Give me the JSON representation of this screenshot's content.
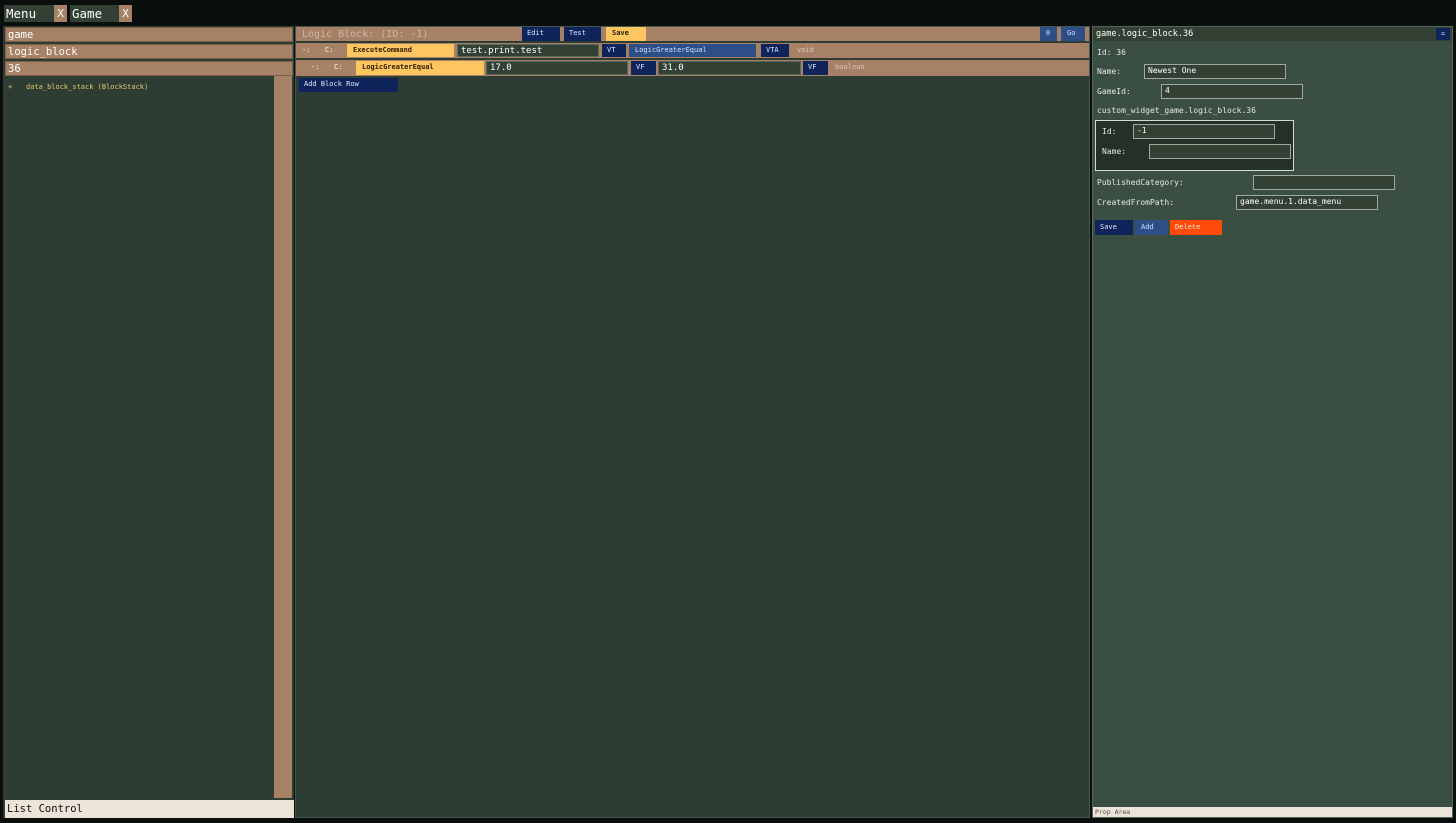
{
  "tabs": [
    {
      "label": "Menu",
      "close": "X"
    },
    {
      "label": "Game",
      "close": "X"
    }
  ],
  "left": {
    "breadcrumbs": [
      "game",
      "logic_block",
      "36"
    ],
    "tree": [
      {
        "toggle": "+",
        "label": "data_block_stack (BlockStack)"
      }
    ],
    "footer": "List Control"
  },
  "middle": {
    "title": "Logic Block:  (ID: -1)",
    "toolbar": {
      "edit": "Edit",
      "test": "Test",
      "save": "Save",
      "zero": "0",
      "go": "Go"
    },
    "rows": [
      {
        "dash": "-:",
        "c": "C:",
        "command": "ExecuteCommand",
        "value": "test.print.test",
        "tag1": "VT",
        "type": "LogicGreaterEqual",
        "tag2": "VTA",
        "ret": "void"
      },
      {
        "dash": "-:",
        "c": "C:",
        "command": "LogicGreaterEqual",
        "value": "17.0",
        "tag1": "VF",
        "value2": "31.0",
        "tag2": "VF",
        "ret": "boolean"
      }
    ],
    "add_row": "Add Block Row"
  },
  "right": {
    "header": "game.logic_block.36",
    "collapse": "=",
    "id_text": "Id: 36",
    "name_label": "Name:",
    "name_value": "Newest One",
    "gameid_label": "GameId:",
    "gameid_value": "4",
    "widget_path": "custom_widget_game.logic_block.36",
    "sub": {
      "id_label": "Id:",
      "id_value": "-1",
      "name_label": "Name:",
      "name_value": ""
    },
    "published_label": "PublishedCategory:",
    "published_value": "",
    "created_label": "CreatedFromPath:",
    "created_value": "game.menu.1.data_menu",
    "buttons": {
      "save": "Save",
      "add": "Add",
      "delete": "Delete"
    },
    "footer": "Prop Area"
  },
  "colors": {
    "panel": "#2d3d34",
    "tan": "#a68165",
    "navy": "#0e245a",
    "yellow": "#ffc561",
    "blue": "#2d4e86",
    "delete": "#ff4b0a",
    "cream": "#ede4d9"
  }
}
